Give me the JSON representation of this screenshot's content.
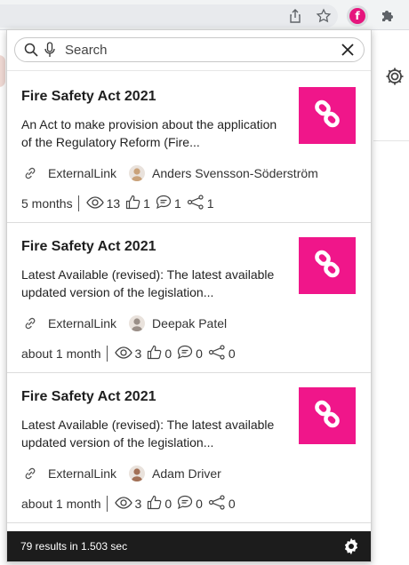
{
  "search": {
    "placeholder": "Search"
  },
  "results": [
    {
      "title": "Fire Safety Act 2021",
      "description": "An Act to make provision about the application of the Regulatory Reform (Fire...",
      "type": "ExternalLink",
      "author": "Anders Svensson-Söderström",
      "age": "5 months",
      "views": "13",
      "likes": "1",
      "comments": "1",
      "shares": "1",
      "avatar_color": "#c9a27a"
    },
    {
      "title": "Fire Safety Act 2021",
      "description": "Latest Available (revised): The latest available updated version of the legislation...",
      "type": "ExternalLink",
      "author": "Deepak Patel",
      "age": "about 1 month",
      "views": "3",
      "likes": "0",
      "comments": "0",
      "shares": "0",
      "avatar_color": "#9a8f88"
    },
    {
      "title": "Fire Safety Act 2021",
      "description": "Latest Available (revised): The latest available updated version of the legislation...",
      "type": "ExternalLink",
      "author": "Adam Driver",
      "age": "about 1 month",
      "views": "3",
      "likes": "0",
      "comments": "0",
      "shares": "0",
      "avatar_color": "#a27056"
    }
  ],
  "footer": {
    "summary": "79 results in 1.503 sec"
  },
  "extension": {
    "badge_letter": "f"
  },
  "colors": {
    "accent": "#f0168a",
    "footer_bg": "#1c1c1c"
  }
}
